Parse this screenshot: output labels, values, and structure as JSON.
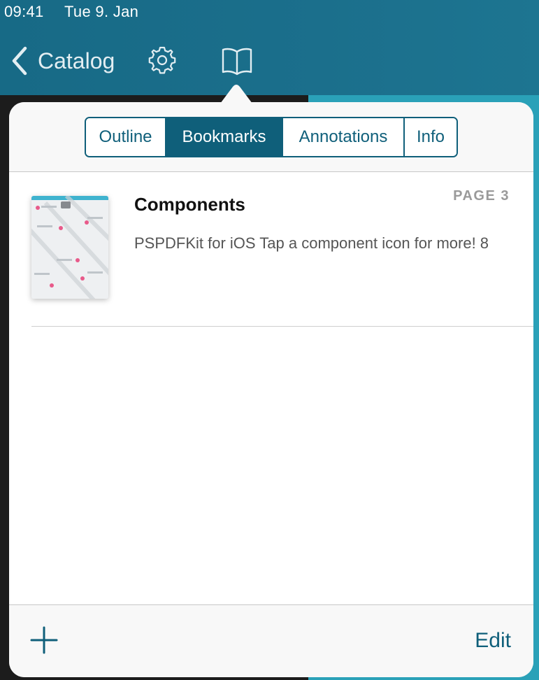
{
  "status_bar": {
    "time": "09:41",
    "date": "Tue 9. Jan"
  },
  "nav": {
    "back_label": "Catalog",
    "settings_icon": "gear-icon",
    "outline_icon": "book-icon"
  },
  "popover": {
    "tabs": [
      {
        "label": "Outline",
        "active": false
      },
      {
        "label": "Bookmarks",
        "active": true
      },
      {
        "label": "Annotations",
        "active": false
      },
      {
        "label": "Info",
        "active": false
      }
    ],
    "bookmarks": [
      {
        "title": "Components",
        "page_label": "PAGE 3",
        "description": "PSPDFKit for iOS Tap a component icon for more! 8"
      }
    ],
    "footer": {
      "add_icon": "plus-icon",
      "edit_label": "Edit"
    }
  },
  "colors": {
    "nav_bar": "#1b6f8c",
    "accent": "#0f5f7a",
    "background_page": "#2aa1b8"
  }
}
